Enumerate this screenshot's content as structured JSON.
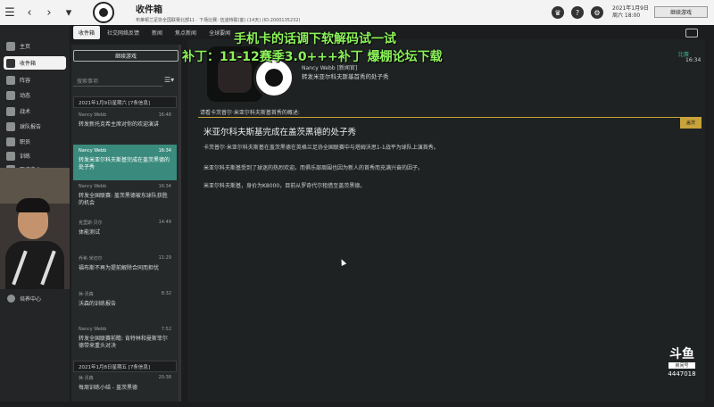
{
  "topbar": {
    "title": "收件箱",
    "subtitle": "布莱顿兰足协全国联赛北部11 · 下场比赛: 伍迪特联(客) (14天) (ID:2000135232)",
    "date": "2021年1月9日",
    "weekday": "周六 18:00",
    "continue_label": "继续游戏"
  },
  "tabs": [
    "收件箱",
    "社交网络反馈",
    "新闻",
    "焦点新闻",
    "全球要闻"
  ],
  "sidebar": {
    "items": [
      "主页",
      "收件箱",
      "阵容",
      "动态",
      "战术",
      "球队报告",
      "职员",
      "训练",
      "医疗中心"
    ],
    "bottom_item": "培养中心"
  },
  "list": {
    "continue_label": "继续游戏",
    "search_placeholder": "搜索事项",
    "groups": [
      {
        "label": "2021年1月9日星期六 [7条信息]"
      },
      {
        "label": "2021年1月8日星期五 [7条信息]"
      }
    ],
    "messages": [
      {
        "sender": "Nancy Webb",
        "time": "16:48",
        "subject": "转发新托克希主席对你的欢迎演讲"
      },
      {
        "sender": "Nancy Webb",
        "time": "16:34",
        "subject": "转发米亚尔科夫斯基完成在盖茨黑德的处子秀"
      },
      {
        "sender": "Nancy Webb",
        "time": "16:34",
        "subject": "转发全国联赛: 盖茨黑德被东球队获胜的机会"
      },
      {
        "sender": "克里斯·贝尔",
        "time": "14:49",
        "subject": "体能测试"
      },
      {
        "sender": "乔希·米切尔",
        "time": "11:29",
        "subject": "福布斯不再为提前解除合同而担忧"
      },
      {
        "sender": "休·沃森",
        "time": "8:32",
        "subject": "沃森的训练报告"
      },
      {
        "sender": "Nancy Webb",
        "time": "7:52",
        "subject": "转发全国联赛前瞻: 肯特林和曼斯菲尔德带来重头对决"
      },
      {
        "sender": "休·沃森",
        "time": "20:38",
        "subject": "每周训练小结 - 盖茨黑德"
      }
    ]
  },
  "message_view": {
    "from": "Nancy Webb [新闻官]",
    "subject": "转发米亚尔科夫斯基首秀的处子秀",
    "category": "比赛",
    "time": "16:34",
    "intro": "请看卡茨普尔·米亚尔科夫斯基首秀的概述:",
    "tag": "盖茨",
    "title": "米亚尔科夫斯基完成在盖茨黑德的处子秀",
    "paragraphs": [
      "卡茨普尔·米亚尔科夫斯基在盖茨黑德在英格兰足协全国联赛中与塔姆沃思1-1战平为球队上演首秀。",
      "米亚尔科夫斯基受到了球迷的热烈欢迎。而俱乐部周围也因为新人的首秀而充满兴奋的因子。",
      "米亚尔科夫斯基，身价为K8000，目前从罗奇代尔租借至盖茨黑德。"
    ]
  },
  "overlay": {
    "line1": "手机卡的话调下软解码试一试",
    "line2": "补丁：11-12赛季3.0+++补丁 爆棚论坛下载"
  },
  "stream": {
    "logo_text": "斗鱼",
    "logo_sub": "房间号",
    "room_id": "4447018"
  },
  "colors": {
    "accent_green": "#3a8a7d",
    "gold": "#c8a33a",
    "overlay_text": "#8cf25a"
  }
}
